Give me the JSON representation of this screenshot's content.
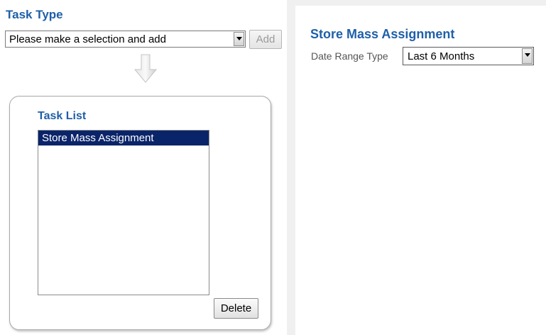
{
  "task_type": {
    "title": "Task Type",
    "select_value": "Please make a selection and add",
    "add_label": "Add"
  },
  "task_list": {
    "title": "Task List",
    "items": [
      "Store Mass Assignment"
    ],
    "selected_index": 0,
    "delete_label": "Delete"
  },
  "detail": {
    "title": "Store Mass Assignment",
    "date_range_label": "Date Range Type",
    "date_range_value": "Last 6 Months"
  },
  "colors": {
    "heading": "#1f5fa8",
    "selection": "#0a246a"
  },
  "icons": {
    "dropdown": "chevron-down-icon",
    "flow": "down-arrow-icon"
  }
}
